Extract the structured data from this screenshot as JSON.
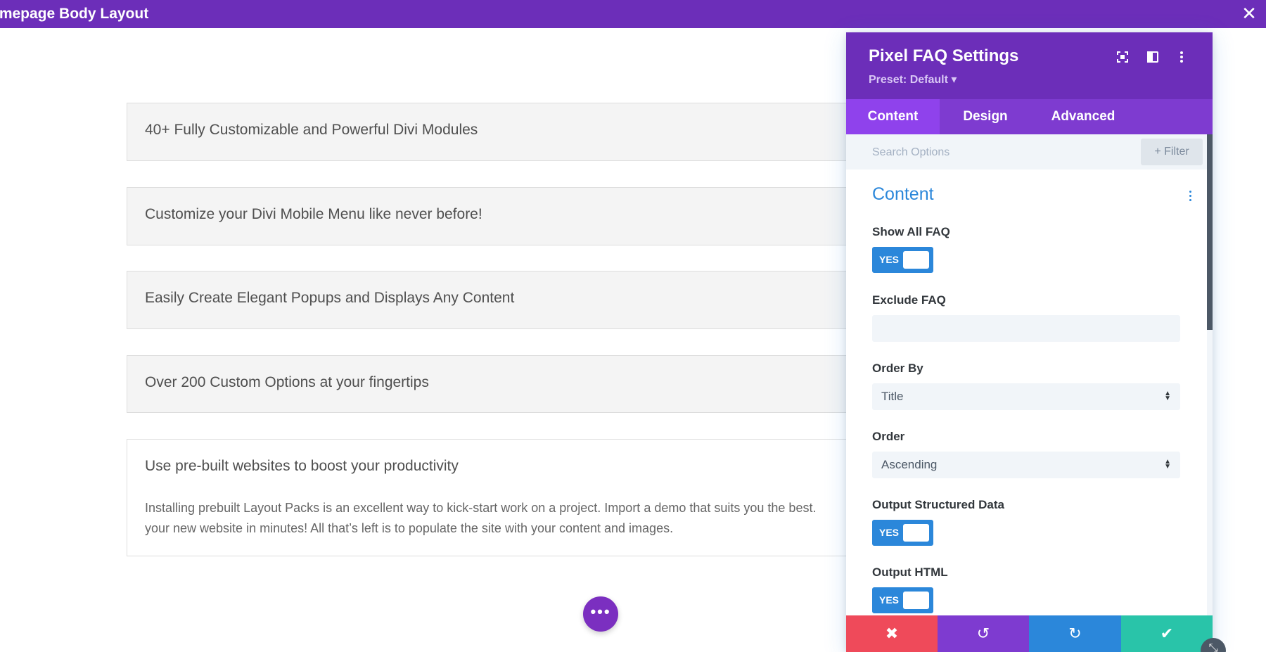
{
  "topbar": {
    "title": "omepage Body Layout",
    "close_glyph": "✕"
  },
  "faq_items": [
    {
      "title": "40+ Fully Customizable and Powerful Divi Modules"
    },
    {
      "title": "Customize your Divi Mobile Menu like never before!"
    },
    {
      "title": "Easily Create Elegant Popups and Displays Any Content"
    },
    {
      "title": "Over 200 Custom Options at your fingertips"
    },
    {
      "title": "Use pre-built websites to boost your productivity",
      "body_line1": "Installing prebuilt Layout Packs is an excellent way to kick-start work on a project. Import a demo that suits you the best.",
      "body_line2": "your new website in minutes! All that’s left is to populate the site with your content and images."
    }
  ],
  "fab": {
    "glyph": "•••"
  },
  "panel": {
    "title": "Pixel FAQ Settings",
    "preset": "Preset: Default ▾",
    "icons": [
      "fullscreen-icon",
      "split-view-icon",
      "more-options-icon"
    ],
    "tabs": [
      {
        "label": "Content",
        "active": true
      },
      {
        "label": "Design",
        "active": false
      },
      {
        "label": "Advanced",
        "active": false
      }
    ],
    "search_placeholder": "Search Options",
    "filter_label": "+ Filter",
    "section_title": "Content",
    "options": {
      "show_all_faq": {
        "label": "Show All FAQ",
        "value": "YES"
      },
      "exclude_faq": {
        "label": "Exclude FAQ",
        "value": ""
      },
      "order_by": {
        "label": "Order By",
        "value": "Title"
      },
      "order": {
        "label": "Order",
        "value": "Ascending"
      },
      "structured_data": {
        "label": "Output Structured Data",
        "value": "YES"
      },
      "output_html": {
        "label": "Output HTML",
        "value": "YES"
      }
    },
    "footer": {
      "cancel_glyph": "✖",
      "undo_glyph": "↺",
      "redo_glyph": "↻",
      "save_glyph": "✔",
      "colors": {
        "cancel": "#ef4a5a",
        "undo": "#7e3bd0",
        "redo": "#2b87da",
        "save": "#29c4a9"
      }
    }
  },
  "colors": {
    "brand_purple": "#6c2eb9",
    "tab_active": "#8f42ec",
    "accent_blue": "#2b87da"
  }
}
